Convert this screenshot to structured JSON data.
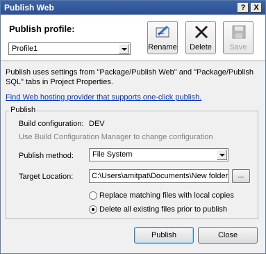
{
  "window": {
    "title": "Publish Web",
    "help_btn": "?",
    "close_btn": "X"
  },
  "header": {
    "profile_label": "Publish profile:",
    "profile_value": "Profile1",
    "rename_label": "Rename",
    "delete_label": "Delete",
    "save_label": "Save"
  },
  "description": "Publish uses settings from \"Package/Publish Web\" and \"Package/Publish SQL\" tabs in Project Properties.",
  "link_text": "Find Web hosting provider that supports one-click publish.",
  "publish_group": {
    "title": "Publish",
    "build_config_label": "Build configuration:",
    "build_config_value": "DEV",
    "build_config_hint": "Use Build Configuration Manager to change configuration",
    "method_label": "Publish method:",
    "method_value": "File System",
    "target_label": "Target Location:",
    "target_value": "C:\\Users\\amitpat\\Documents\\New folder",
    "browse_label": "...",
    "radio_replace": "Replace matching files with local copies",
    "radio_delete": "Delete all existing files prior to publish"
  },
  "footer": {
    "publish_label": "Publish",
    "close_label": "Close"
  },
  "colors": {
    "titlebar": "#2b4f91",
    "link": "#0033cc"
  }
}
